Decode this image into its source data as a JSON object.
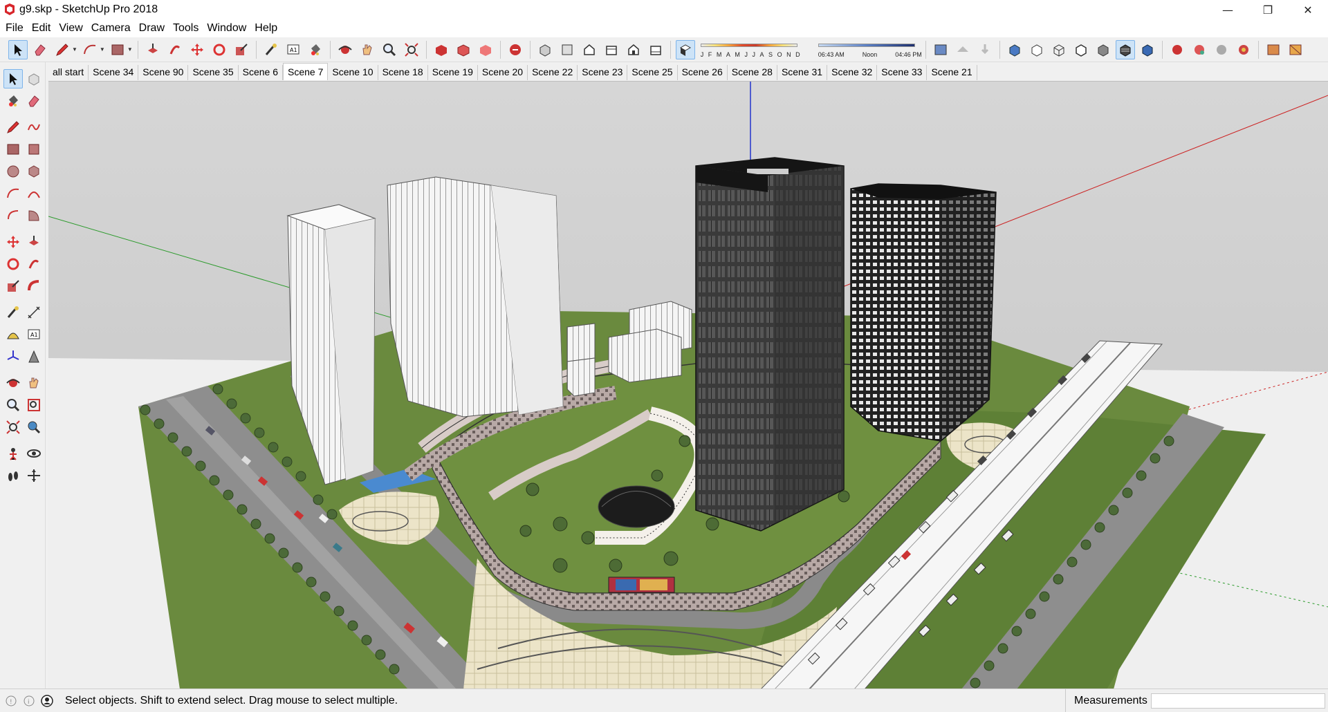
{
  "window": {
    "title": "g9.skp - SketchUp Pro 2018",
    "controls": {
      "minimize": "—",
      "restore": "❐",
      "close": "✕"
    }
  },
  "menu": [
    "File",
    "Edit",
    "View",
    "Camera",
    "Draw",
    "Tools",
    "Window",
    "Help"
  ],
  "toolbar": {
    "shadow_months": [
      "J",
      "F",
      "M",
      "A",
      "M",
      "J",
      "J",
      "A",
      "S",
      "O",
      "N",
      "D"
    ],
    "shadow_times": [
      "06:43 AM",
      "Noon",
      "04:46 PM"
    ]
  },
  "scenes": {
    "tabs": [
      "all start",
      "Scene 34",
      "Scene 90",
      "Scene 35",
      "Scene 6",
      "Scene 7",
      "Scene 10",
      "Scene 18",
      "Scene 19",
      "Scene 20",
      "Scene 22",
      "Scene 23",
      "Scene 25",
      "Scene 26",
      "Scene 28",
      "Scene 31",
      "Scene 32",
      "Scene 33",
      "Scene 21"
    ],
    "active": "Scene 7"
  },
  "status": {
    "message": "Select objects. Shift to extend select. Drag mouse to select multiple.",
    "measurements_label": "Measurements",
    "measurements_value": ""
  },
  "colors": {
    "sky": "#c8c8c8",
    "ground": "#f2f2f2",
    "grass": "#6a8a3e",
    "road": "#8e8e8e",
    "tower_dark": "#2a2a2a",
    "tower_white": "#f4f4f4",
    "axis_red": "#cc2222",
    "axis_green": "#2a9a2a",
    "axis_blue": "#2233cc"
  }
}
